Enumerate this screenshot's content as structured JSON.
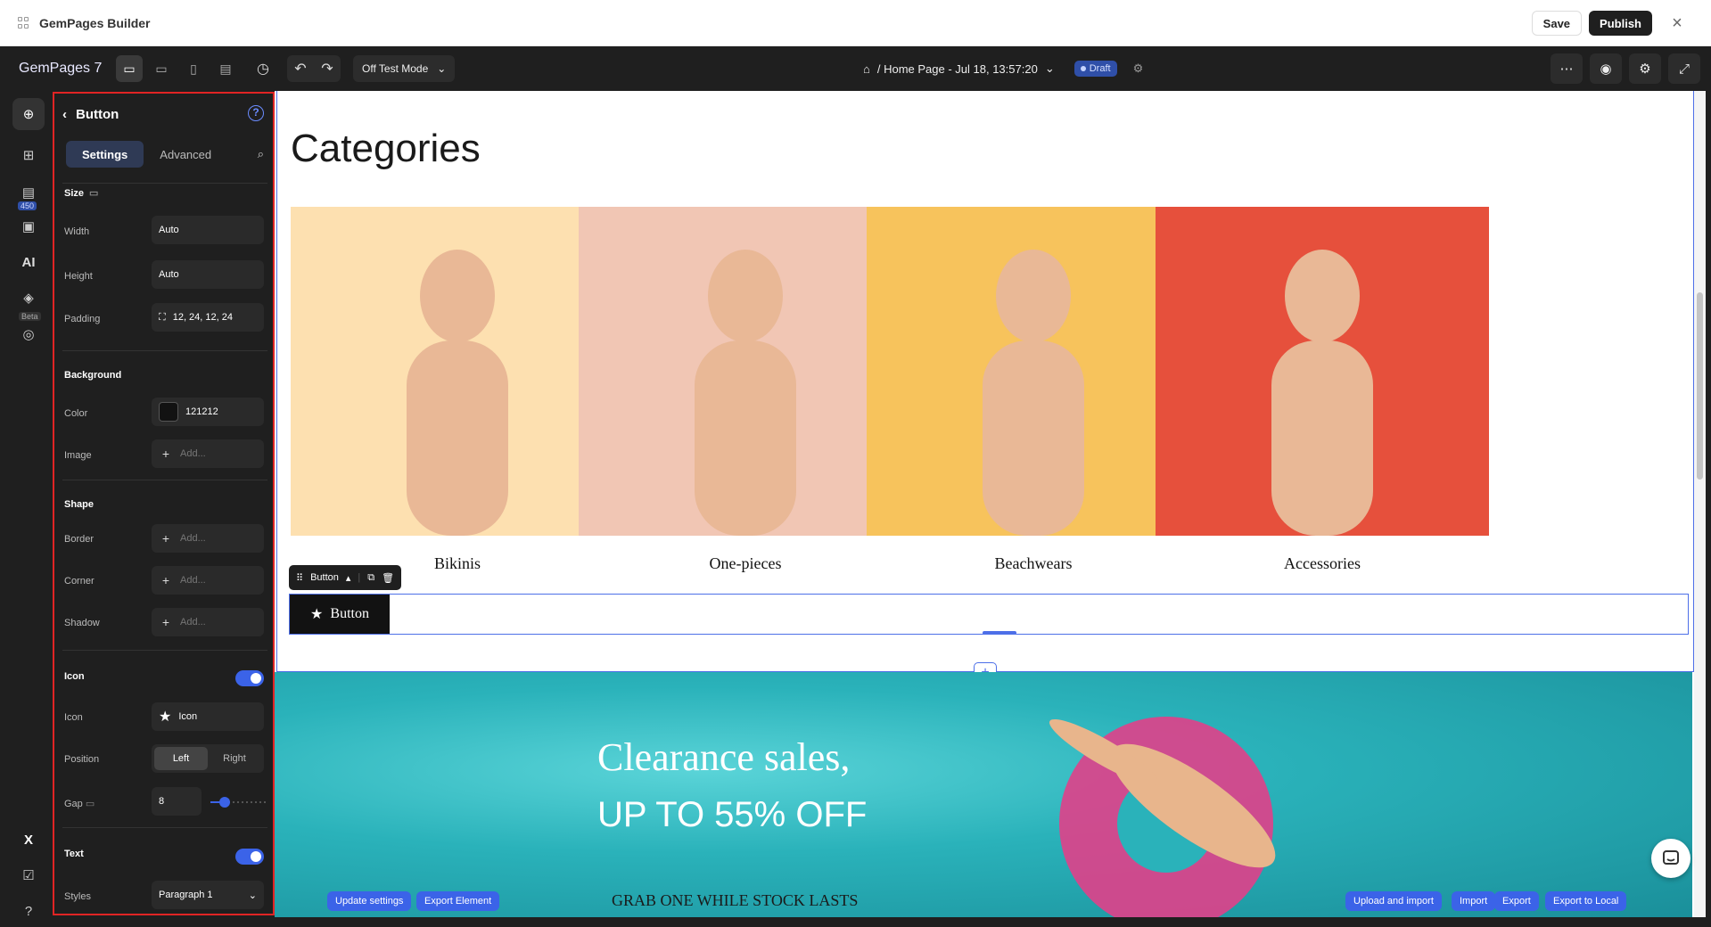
{
  "window": {
    "title": "GemPages Builder",
    "save_label": "Save",
    "publish_label": "Publish",
    "close_icon": "close-icon"
  },
  "topbar": {
    "brand": "GemPages 7",
    "test_mode": "Off Test Mode",
    "page_title": "/ Home Page - Jul 18, 13:57:20",
    "status": "Draft"
  },
  "rail": {
    "badge_count": "450",
    "beta_label": "Beta"
  },
  "panel": {
    "title": "Button",
    "tabs": [
      "Settings",
      "Advanced"
    ],
    "active_tab": "Settings",
    "size": {
      "title": "Size",
      "width_label": "Width",
      "width": "Auto",
      "height_label": "Height",
      "height": "Auto",
      "padding_label": "Padding",
      "padding": "12, 24, 12, 24"
    },
    "background": {
      "title": "Background",
      "color_label": "Color",
      "color": "121212",
      "image_label": "Image",
      "image_placeholder": "Add..."
    },
    "shape": {
      "title": "Shape",
      "border_label": "Border",
      "border_placeholder": "Add...",
      "corner_label": "Corner",
      "corner_placeholder": "Add...",
      "shadow_label": "Shadow",
      "shadow_placeholder": "Add..."
    },
    "icon": {
      "title": "Icon",
      "enabled": true,
      "icon_label": "Icon",
      "icon_value": "Icon",
      "position_label": "Position",
      "position_options": [
        "Left",
        "Right"
      ],
      "position_selected": "Left",
      "gap_label": "Gap",
      "gap": "8",
      "gap_fraction": 0.25
    },
    "text": {
      "title": "Text",
      "enabled": true,
      "styles_label": "Styles",
      "styles_value": "Paragraph 1"
    }
  },
  "canvas": {
    "section_title": "Categories",
    "categories": [
      {
        "label": "Bikinis",
        "bg": "#fde0b0"
      },
      {
        "label": "One-pieces",
        "bg": "#f1c6b4"
      },
      {
        "label": "Beachwears",
        "bg": "#f7c35c"
      },
      {
        "label": "Accessories",
        "bg": "#e6503c"
      }
    ],
    "element_toolbar_label": "Button",
    "button_label": "Button",
    "hero": {
      "line1": "Clearance sales,",
      "line2": "UP TO 55% OFF",
      "sub": "GRAB ONE WHILE STOCK LASTS"
    },
    "pills_left": [
      "Update settings",
      "Export Element"
    ],
    "pills_right": [
      "Upload and import",
      "Import",
      "Export",
      "Export to Local"
    ]
  },
  "colors": {
    "accent": "#3b63e8",
    "selection": "#4d6fe8",
    "button_bg": "#121212",
    "highlight_outline": "#e02424"
  }
}
